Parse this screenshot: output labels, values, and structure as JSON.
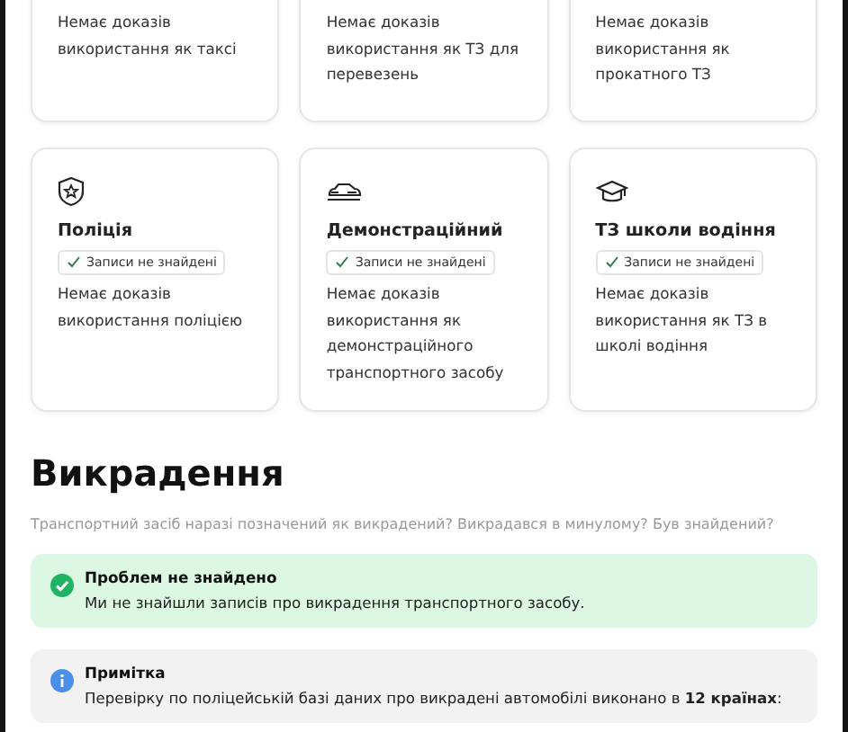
{
  "cards": [
    {
      "description": "Немає доказів використання як таксі"
    },
    {
      "description": "Немає доказів використання як ТЗ для перевезень"
    },
    {
      "description": "Немає доказів використання як прокатного ТЗ"
    },
    {
      "kind": "police",
      "title": "Поліція",
      "badge": "Записи не знайдені",
      "description": "Немає доказів використання поліцією"
    },
    {
      "kind": "demo",
      "title": "Демонстраційний",
      "badge": "Записи не знайдені",
      "description": "Немає доказів використання як демонстраційного транспортного засобу"
    },
    {
      "kind": "school",
      "title": "ТЗ школи водіння",
      "badge": "Записи не знайдені",
      "description": "Немає доказів використання як ТЗ в школі водіння"
    }
  ],
  "section": {
    "heading": "Викрадення",
    "subtitle": "Транспортний засіб наразі позначений як викрадений? Викрадався в минулому? Був знайдений?",
    "alerts": [
      {
        "kind": "success",
        "title": "Проблем не знайдено",
        "text": "Ми не знайшли записів про викрадення транспортного засобу."
      },
      {
        "kind": "info",
        "title": "Примітка",
        "text": "Перевірку по поліцейській базі даних про викрадені автомобілі виконано в **12 країнах**:"
      }
    ]
  }
}
